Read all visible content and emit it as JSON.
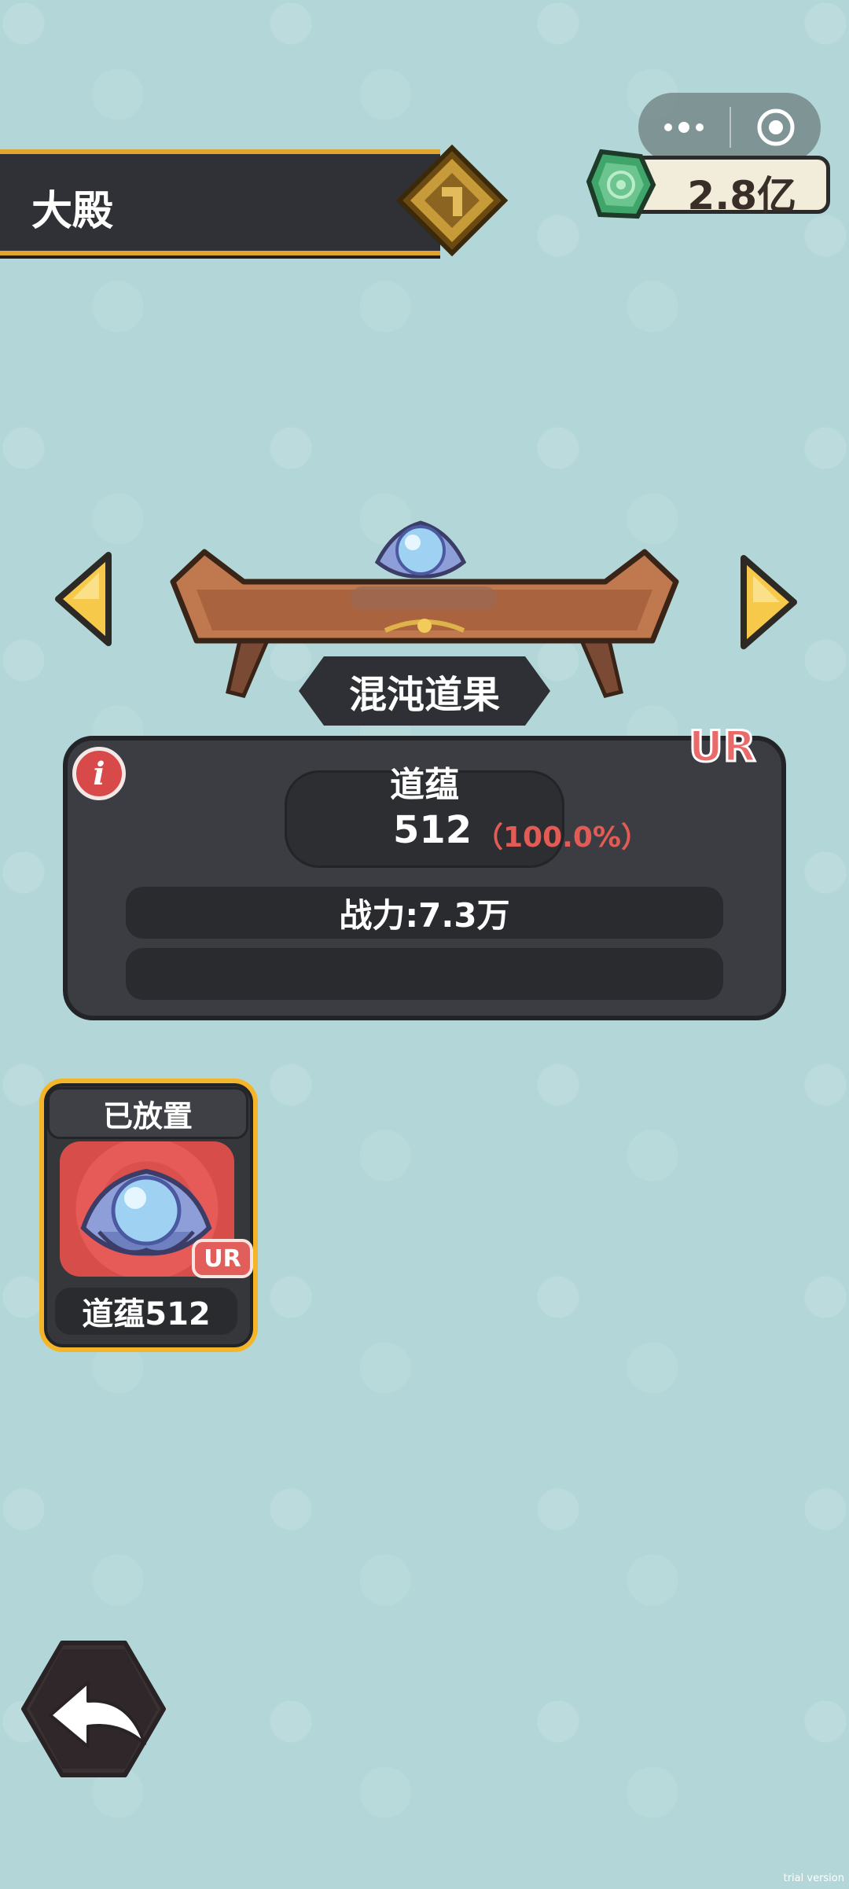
{
  "header": {
    "title": "大殿"
  },
  "capsule": {
    "more_icon": "more-dots-icon",
    "close_icon": "target-circle-icon"
  },
  "currency": {
    "icon": "jade-gem-icon",
    "amount": "2.8亿"
  },
  "pedestal": {
    "item_name": "混沌道果",
    "rarity": "UR",
    "stat_label": "道蕴",
    "stat_value": "512",
    "stat_percent": "（100.0%）",
    "power_text": "战力:7.3万",
    "colors": {
      "rarity": "#e96a6a",
      "percent": "#e45b55",
      "accent": "#f5b52a"
    }
  },
  "inventory": [
    {
      "status": "已放置",
      "rarity": "UR",
      "caption": "道蕴512"
    }
  ],
  "footer": {
    "watermark": "trial version"
  }
}
